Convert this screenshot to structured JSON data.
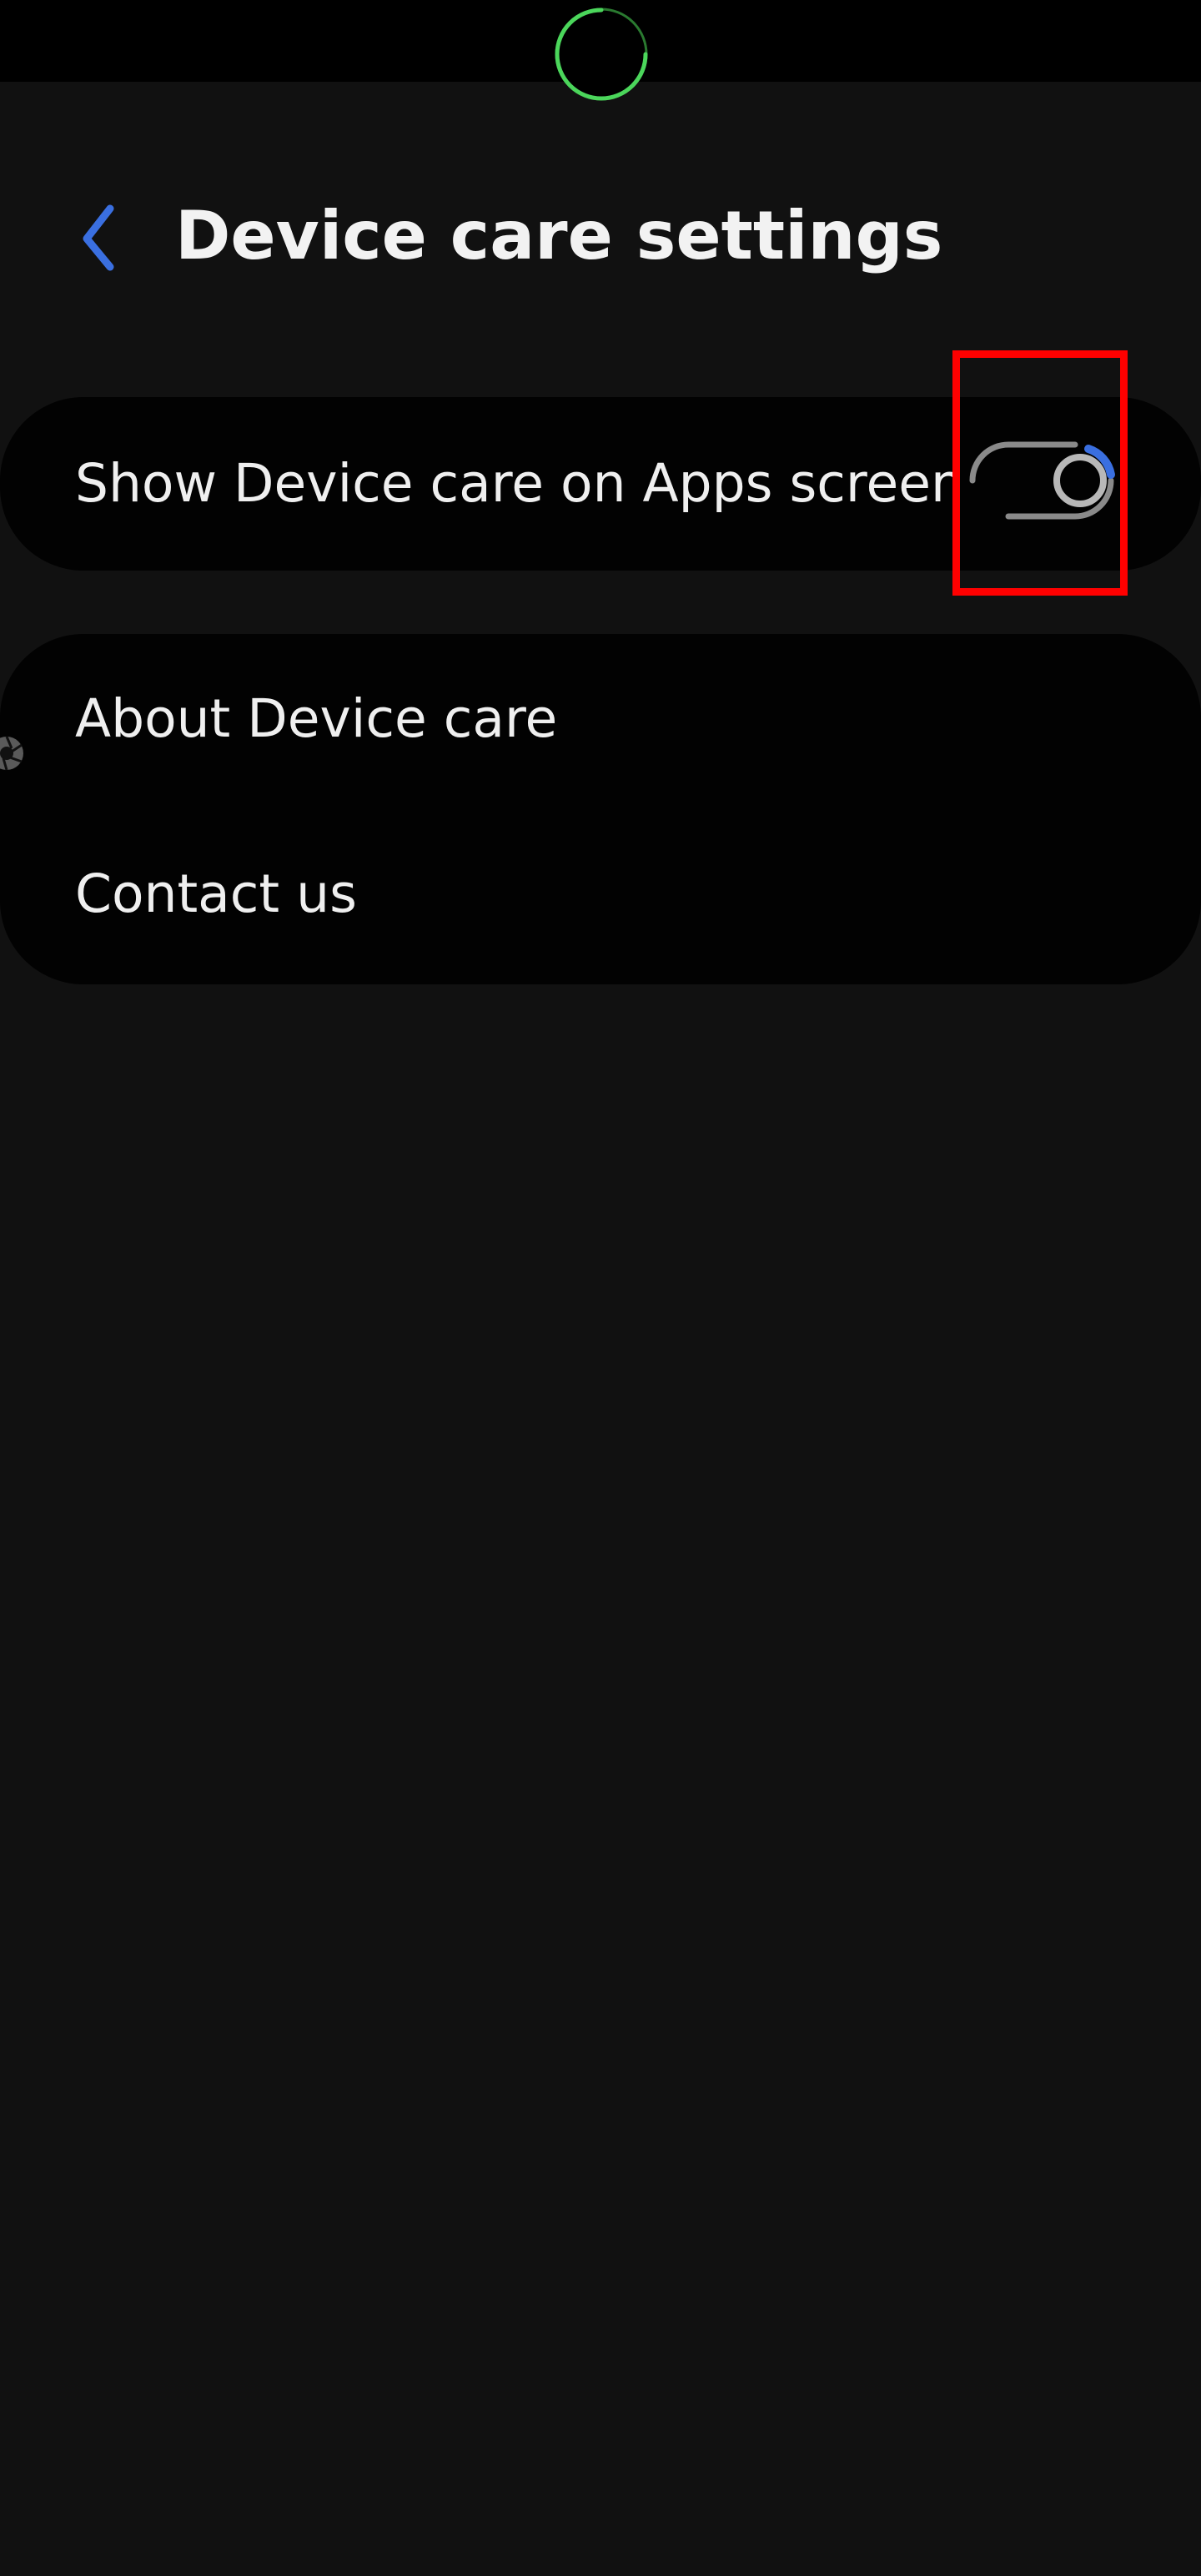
{
  "colors": {
    "background": "#111111",
    "status_bar": "#000000",
    "card": "#020202",
    "accent_blue": "#3a6fe0",
    "camera_ring": "#4bd65b",
    "highlight_box": "#ff0000",
    "switch_off": "#8a8a8a",
    "text_primary": "#efefef"
  },
  "header": {
    "back_icon": "chevron-left-icon",
    "title": "Device care settings"
  },
  "settings": {
    "show_on_apps_screen": {
      "label": "Show Device care on Apps screen",
      "state": "off"
    }
  },
  "links": [
    {
      "label": "About Device care"
    },
    {
      "label": "Contact us"
    }
  ],
  "icons": {
    "status_camera": "camera-cutout-icon",
    "side_edge": "aperture-icon"
  }
}
